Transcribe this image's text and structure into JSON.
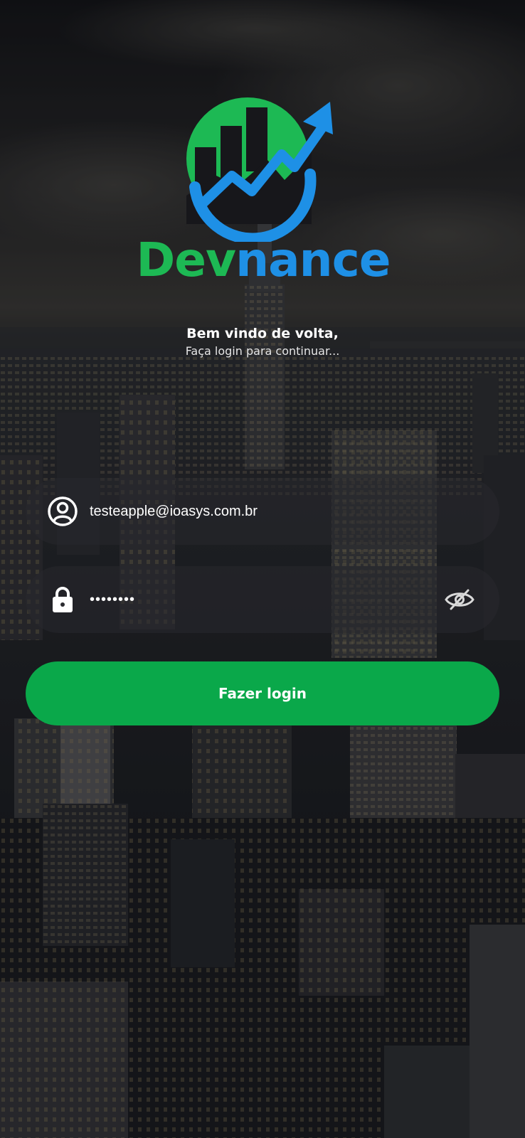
{
  "brand": {
    "name_part1": "Dev",
    "name_part2": "nance",
    "color_green": "#1db954",
    "color_blue": "#1e90e6",
    "logo_icon": "chart-growth-icon"
  },
  "welcome": {
    "title": "Bem vindo de volta,",
    "subtitle": "Faça login para continuar..."
  },
  "login_form": {
    "email": {
      "value": "testeapple@ioasys.com.br",
      "icon": "user-circle-icon"
    },
    "password": {
      "value": "12345678",
      "icon": "lock-icon",
      "toggle_icon": "eye-off-icon"
    },
    "submit_label": "Fazer login",
    "submit_color": "#0aa84a"
  }
}
